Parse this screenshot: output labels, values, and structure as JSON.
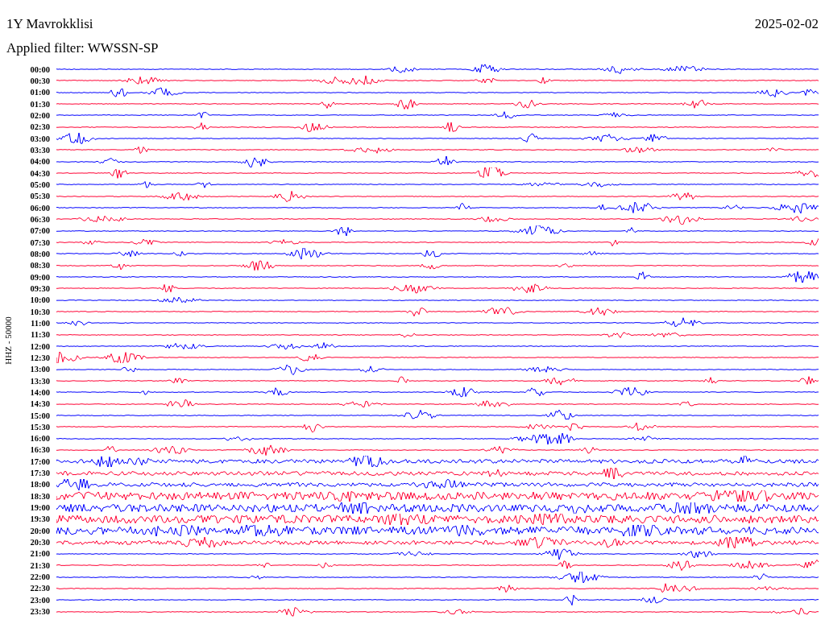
{
  "title": "1Y Mavrokklisi",
  "date": "2025-02-02",
  "filter": "Applied filter: WWSSN-SP",
  "axis_label": "HHZ - 50000",
  "rows": [
    {
      "time": "00:00",
      "color": "#0000ff"
    },
    {
      "time": "00:30",
      "color": "#ff0033"
    },
    {
      "time": "01:00",
      "color": "#0000ff"
    },
    {
      "time": "01:30",
      "color": "#ff0033"
    },
    {
      "time": "02:00",
      "color": "#0000ff"
    },
    {
      "time": "02:30",
      "color": "#ff0033"
    },
    {
      "time": "03:00",
      "color": "#0000ff"
    },
    {
      "time": "03:30",
      "color": "#ff0033"
    },
    {
      "time": "04:00",
      "color": "#0000ff"
    },
    {
      "time": "04:30",
      "color": "#ff0033"
    },
    {
      "time": "05:00",
      "color": "#0000ff"
    },
    {
      "time": "05:30",
      "color": "#ff0033"
    },
    {
      "time": "06:00",
      "color": "#0000ff"
    },
    {
      "time": "06:30",
      "color": "#ff0033"
    },
    {
      "time": "07:00",
      "color": "#0000ff"
    },
    {
      "time": "07:30",
      "color": "#ff0033"
    },
    {
      "time": "08:00",
      "color": "#0000ff"
    },
    {
      "time": "08:30",
      "color": "#ff0033"
    },
    {
      "time": "09:00",
      "color": "#0000ff"
    },
    {
      "time": "09:30",
      "color": "#ff0033"
    },
    {
      "time": "10:00",
      "color": "#0000ff"
    },
    {
      "time": "10:30",
      "color": "#ff0033"
    },
    {
      "time": "11:00",
      "color": "#0000ff"
    },
    {
      "time": "11:30",
      "color": "#ff0033"
    },
    {
      "time": "12:00",
      "color": "#0000ff"
    },
    {
      "time": "12:30",
      "color": "#ff0033"
    },
    {
      "time": "13:00",
      "color": "#0000ff"
    },
    {
      "time": "13:30",
      "color": "#ff0033"
    },
    {
      "time": "14:00",
      "color": "#0000ff"
    },
    {
      "time": "14:30",
      "color": "#ff0033"
    },
    {
      "time": "15:00",
      "color": "#0000ff"
    },
    {
      "time": "15:30",
      "color": "#ff0033"
    },
    {
      "time": "16:00",
      "color": "#0000ff"
    },
    {
      "time": "16:30",
      "color": "#ff0033"
    },
    {
      "time": "17:00",
      "color": "#0000ff"
    },
    {
      "time": "17:30",
      "color": "#ff0033"
    },
    {
      "time": "18:00",
      "color": "#0000ff"
    },
    {
      "time": "18:30",
      "color": "#ff0033"
    },
    {
      "time": "19:00",
      "color": "#0000ff"
    },
    {
      "time": "19:30",
      "color": "#ff0033"
    },
    {
      "time": "20:00",
      "color": "#0000ff"
    },
    {
      "time": "20:30",
      "color": "#ff0033"
    },
    {
      "time": "21:00",
      "color": "#0000ff"
    },
    {
      "time": "21:30",
      "color": "#ff0033"
    },
    {
      "time": "22:00",
      "color": "#0000ff"
    },
    {
      "time": "22:30",
      "color": "#ff0033"
    },
    {
      "time": "23:00",
      "color": "#0000ff"
    },
    {
      "time": "23:30",
      "color": "#ff0033"
    }
  ]
}
